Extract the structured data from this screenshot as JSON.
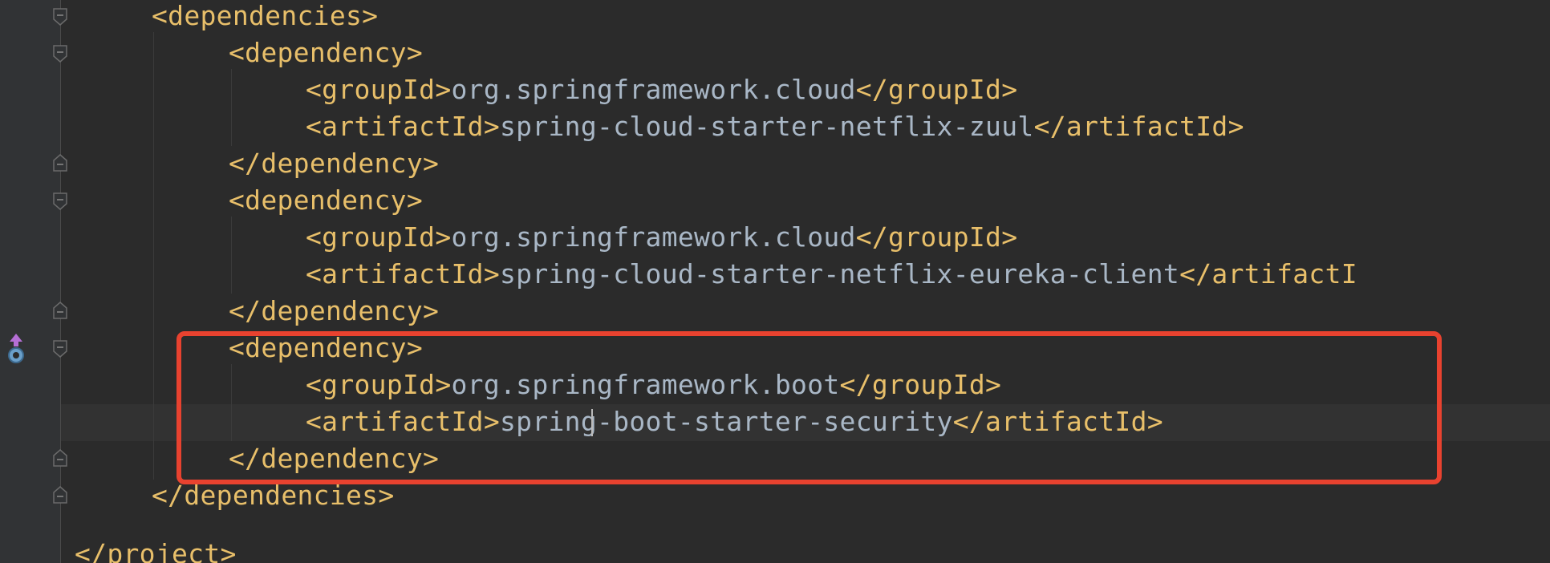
{
  "editor": {
    "lines": [
      {
        "parts": [
          {
            "t": "tag",
            "v": "<dependencies>"
          }
        ]
      },
      {
        "parts": [
          {
            "t": "tag",
            "v": "<dependency>"
          }
        ]
      },
      {
        "parts": [
          {
            "t": "tag",
            "v": "<groupId>"
          },
          {
            "t": "text",
            "v": "org.springframework.cloud"
          },
          {
            "t": "tag",
            "v": "</groupId>"
          }
        ]
      },
      {
        "parts": [
          {
            "t": "tag",
            "v": "<artifactId>"
          },
          {
            "t": "text",
            "v": "spring-cloud-starter-netflix-zuul"
          },
          {
            "t": "tag",
            "v": "</artifactId>"
          }
        ]
      },
      {
        "parts": [
          {
            "t": "tag",
            "v": "</dependency>"
          }
        ]
      },
      {
        "parts": [
          {
            "t": "tag",
            "v": "<dependency>"
          }
        ]
      },
      {
        "parts": [
          {
            "t": "tag",
            "v": "<groupId>"
          },
          {
            "t": "text",
            "v": "org.springframework.cloud"
          },
          {
            "t": "tag",
            "v": "</groupId>"
          }
        ]
      },
      {
        "parts": [
          {
            "t": "tag",
            "v": "<artifactId>"
          },
          {
            "t": "text",
            "v": "spring-cloud-starter-netflix-eureka-client"
          },
          {
            "t": "tag",
            "v": "</artifactI"
          }
        ]
      },
      {
        "parts": [
          {
            "t": "tag",
            "v": "</dependency>"
          }
        ]
      },
      {
        "parts": [
          {
            "t": "tag",
            "v": "<dependency>"
          }
        ]
      },
      {
        "parts": [
          {
            "t": "tag",
            "v": "<groupId>"
          },
          {
            "t": "text",
            "v": "org.springframework.boot"
          },
          {
            "t": "tag",
            "v": "</groupId>"
          }
        ]
      },
      {
        "parts": [
          {
            "t": "tag",
            "v": "<artifactId>"
          },
          {
            "t": "text",
            "v": "spring-boot-starter-security"
          },
          {
            "t": "tag",
            "v": "</artifactId>"
          }
        ]
      },
      {
        "parts": [
          {
            "t": "tag",
            "v": "</dependency>"
          }
        ]
      },
      {
        "parts": [
          {
            "t": "tag",
            "v": "</dependencies>"
          }
        ]
      },
      {
        "parts": []
      },
      {
        "parts": [
          {
            "t": "tag",
            "v": "</project>"
          }
        ]
      }
    ]
  },
  "colors": {
    "background": "#2b2b2b",
    "gutter": "#313335",
    "tag": "#e8bf6a",
    "text": "#a9b7c6",
    "highlight_box": "#e8422f"
  }
}
